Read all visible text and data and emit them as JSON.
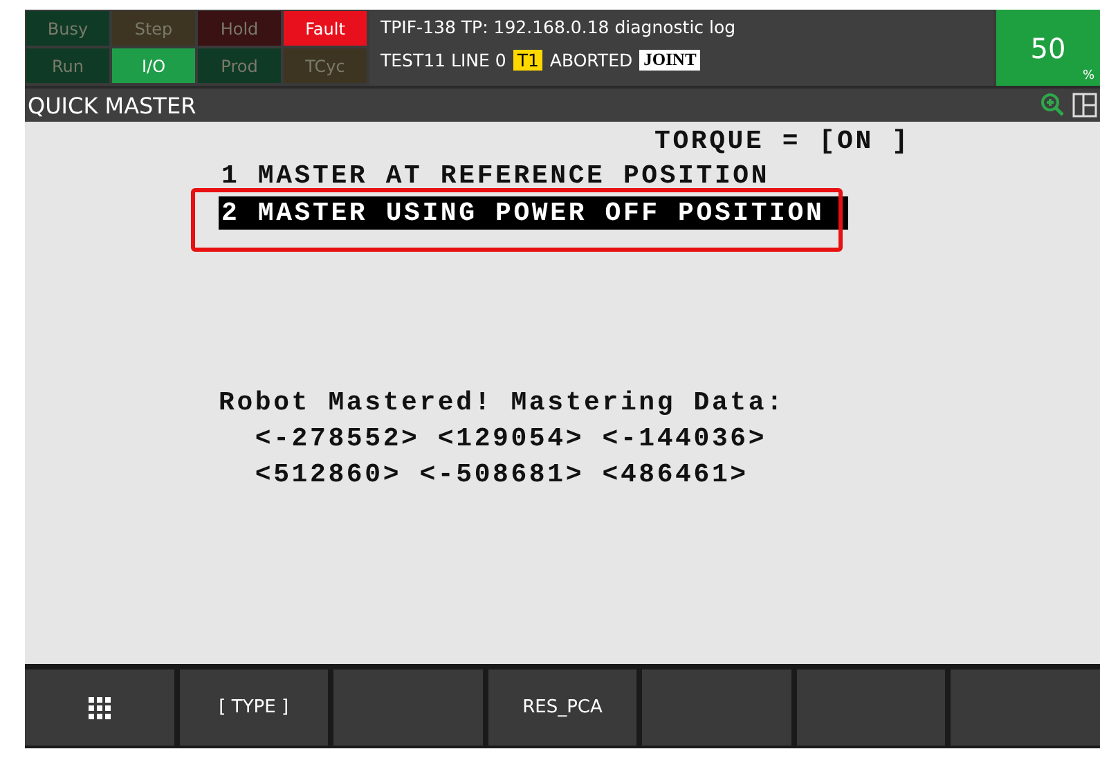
{
  "status_lights": [
    {
      "label": "Busy",
      "kind": "busy",
      "on": false
    },
    {
      "label": "Step",
      "kind": "step",
      "on": false
    },
    {
      "label": "Hold",
      "kind": "hold",
      "on": false
    },
    {
      "label": "Fault",
      "kind": "fault",
      "on": true
    },
    {
      "label": "Run",
      "kind": "busy",
      "on": false
    },
    {
      "label": "I/O",
      "kind": "io",
      "on": true
    },
    {
      "label": "Prod",
      "kind": "busy",
      "on": false
    },
    {
      "label": "TCyc",
      "kind": "step",
      "on": false
    }
  ],
  "status": {
    "line1": "TPIF-138 TP: 192.168.0.18 diagnostic log",
    "program": "TEST11 LINE 0",
    "mode": "T1",
    "state": "ABORTED",
    "coord": "JOINT"
  },
  "override": {
    "value": "50",
    "unit": "%"
  },
  "screen_title": "QUICK MASTER",
  "torque": "TORQUE = [ON ]",
  "menu": [
    {
      "label": "1 MASTER AT REFERENCE POSITION",
      "selected": false
    },
    {
      "label": "2 MASTER USING POWER OFF POSITION",
      "selected": true
    }
  ],
  "message": [
    "Robot Mastered! Mastering Data:",
    "  <-278552> <129054> <-144036>",
    "  <512860> <-508681> <486461>"
  ],
  "function_keys": [
    {
      "kind": "menu"
    },
    {
      "kind": "text",
      "label": "[ TYPE ]"
    },
    {
      "kind": "blank"
    },
    {
      "kind": "text",
      "label": "RES_PCA"
    },
    {
      "kind": "blank"
    },
    {
      "kind": "blank"
    },
    {
      "kind": "blank"
    }
  ]
}
